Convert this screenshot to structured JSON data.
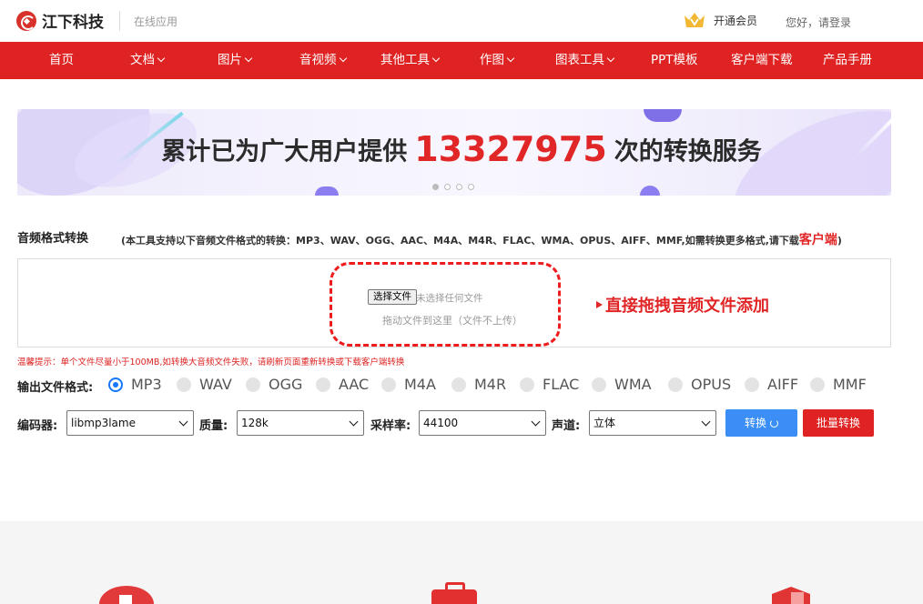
{
  "header": {
    "brand": "江下科技",
    "subtitle": "在线应用",
    "vip_label": "开通会员",
    "login_label": "您好，请登录"
  },
  "nav": {
    "items": [
      {
        "label": "首页"
      },
      {
        "label": "文档"
      },
      {
        "label": "图片"
      },
      {
        "label": "音视频"
      },
      {
        "label": "其他工具"
      },
      {
        "label": "作图"
      },
      {
        "label": "图表工具"
      },
      {
        "label": "PPT模板"
      },
      {
        "label": "客户端下载"
      },
      {
        "label": "产品手册"
      }
    ]
  },
  "banner": {
    "text_before": "累计已为广大用户提供",
    "count": "13327975",
    "text_after": "次的转换服务"
  },
  "tool": {
    "title": "音频格式转换",
    "desc_prefix": "(本工具支持以下音频文件格式的转换：MP3、WAV、OGG、AAC、M4A、M4R、FLAC、WMA、OPUS、AIFF、MMF,如需转换更多格式,请下载",
    "desc_client": "客户端",
    "desc_suffix": ")"
  },
  "upload": {
    "choose_button": "选择文件",
    "no_file_text": "未选择任何文件",
    "drag_hint": "拖动文件到这里（文件不上传）",
    "drop_note": "直接拖拽音频文件添加"
  },
  "warning": "温馨提示：单个文件尽量小于100MB,如转换大音频文件失败，请刷新页面重新转换或下载客户端转换",
  "formats": {
    "label": "输出文件格式:",
    "options": [
      "MP3",
      "WAV",
      "OGG",
      "AAC",
      "M4A",
      "M4R",
      "FLAC",
      "WMA",
      "OPUS",
      "AIFF",
      "MMF"
    ],
    "selected": "MP3"
  },
  "settings": {
    "encoder_label": "编码器:",
    "encoder_value": "libmp3lame",
    "quality_label": "质量:",
    "quality_value": "128k",
    "samplerate_label": "采样率:",
    "samplerate_value": "44100",
    "channel_label": "声道:",
    "channel_value": "立体"
  },
  "actions": {
    "convert": "转换",
    "batch": "批量转换"
  },
  "colors": {
    "brand_red": "#df2222",
    "convert_blue": "#3a8ef6",
    "radio_blue": "#1677ff"
  }
}
